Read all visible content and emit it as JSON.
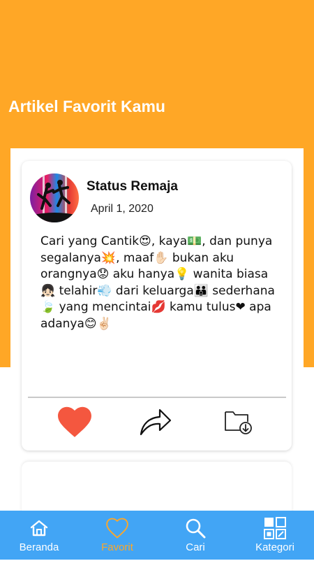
{
  "page": {
    "title": "Artikel Favorit Kamu"
  },
  "colors": {
    "header": "#FFA726",
    "nav": "#42A5F5",
    "active": "#FFA726",
    "heart": "#F4573F"
  },
  "post": {
    "author": "Status Remaja",
    "date": "April 1, 2020",
    "text": "Cari yang Cantik😍, kaya💵, dan punya segalanya💥, maaf✋🏻 bukan aku orangnya😟 aku hanya💡 wanita biasa👧🏻 telahir💨 dari keluarga👪 sederhana🍃 yang mencintai💋 kamu tulus❤ apa adanya😊✌🏻",
    "actions": [
      {
        "icon": "heart-icon",
        "label": "like"
      },
      {
        "icon": "share-icon",
        "label": "share"
      },
      {
        "icon": "folder-download-icon",
        "label": "save"
      }
    ]
  },
  "nav": {
    "items": [
      {
        "label": "Beranda",
        "icon": "home-icon",
        "active": false
      },
      {
        "label": "Favorit",
        "icon": "heart-outline-icon",
        "active": true
      },
      {
        "label": "Cari",
        "icon": "search-icon",
        "active": false
      },
      {
        "label": "Kategori",
        "icon": "grid-icon",
        "active": false
      }
    ]
  }
}
